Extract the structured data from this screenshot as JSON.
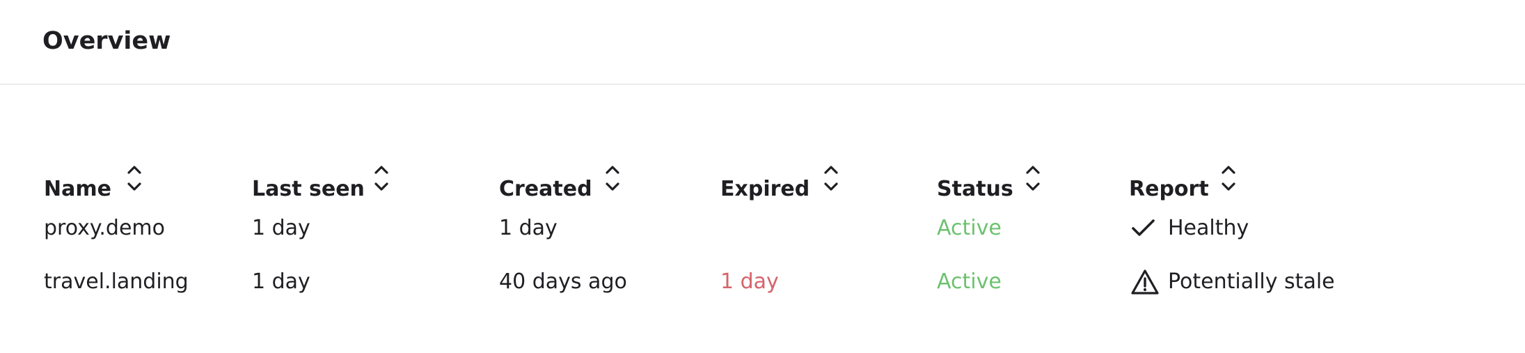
{
  "header": {
    "title": "Overview"
  },
  "table": {
    "columns": [
      {
        "key": "name",
        "label": "Name"
      },
      {
        "key": "last_seen",
        "label": "Last seen"
      },
      {
        "key": "created",
        "label": "Created"
      },
      {
        "key": "expired",
        "label": "Expired"
      },
      {
        "key": "status",
        "label": "Status"
      },
      {
        "key": "report",
        "label": "Report"
      }
    ],
    "sort_icon": "sort-updown-icon",
    "rows": [
      {
        "name": "proxy.demo",
        "last_seen": "1 day",
        "created": "1 day",
        "expired": "",
        "status": "Active",
        "report": "Healthy",
        "report_icon": "check-icon"
      },
      {
        "name": "travel.landing",
        "last_seen": "1 day",
        "created": "40 days ago",
        "expired": "1 day",
        "status": "Active",
        "report": "Potentially stale",
        "report_icon": "warning-triangle-icon"
      }
    ]
  },
  "colors": {
    "text": "#1f1f23",
    "status_active": "#6cc26f",
    "expired_overdue": "#d5646b",
    "divider": "#ebebeb"
  }
}
